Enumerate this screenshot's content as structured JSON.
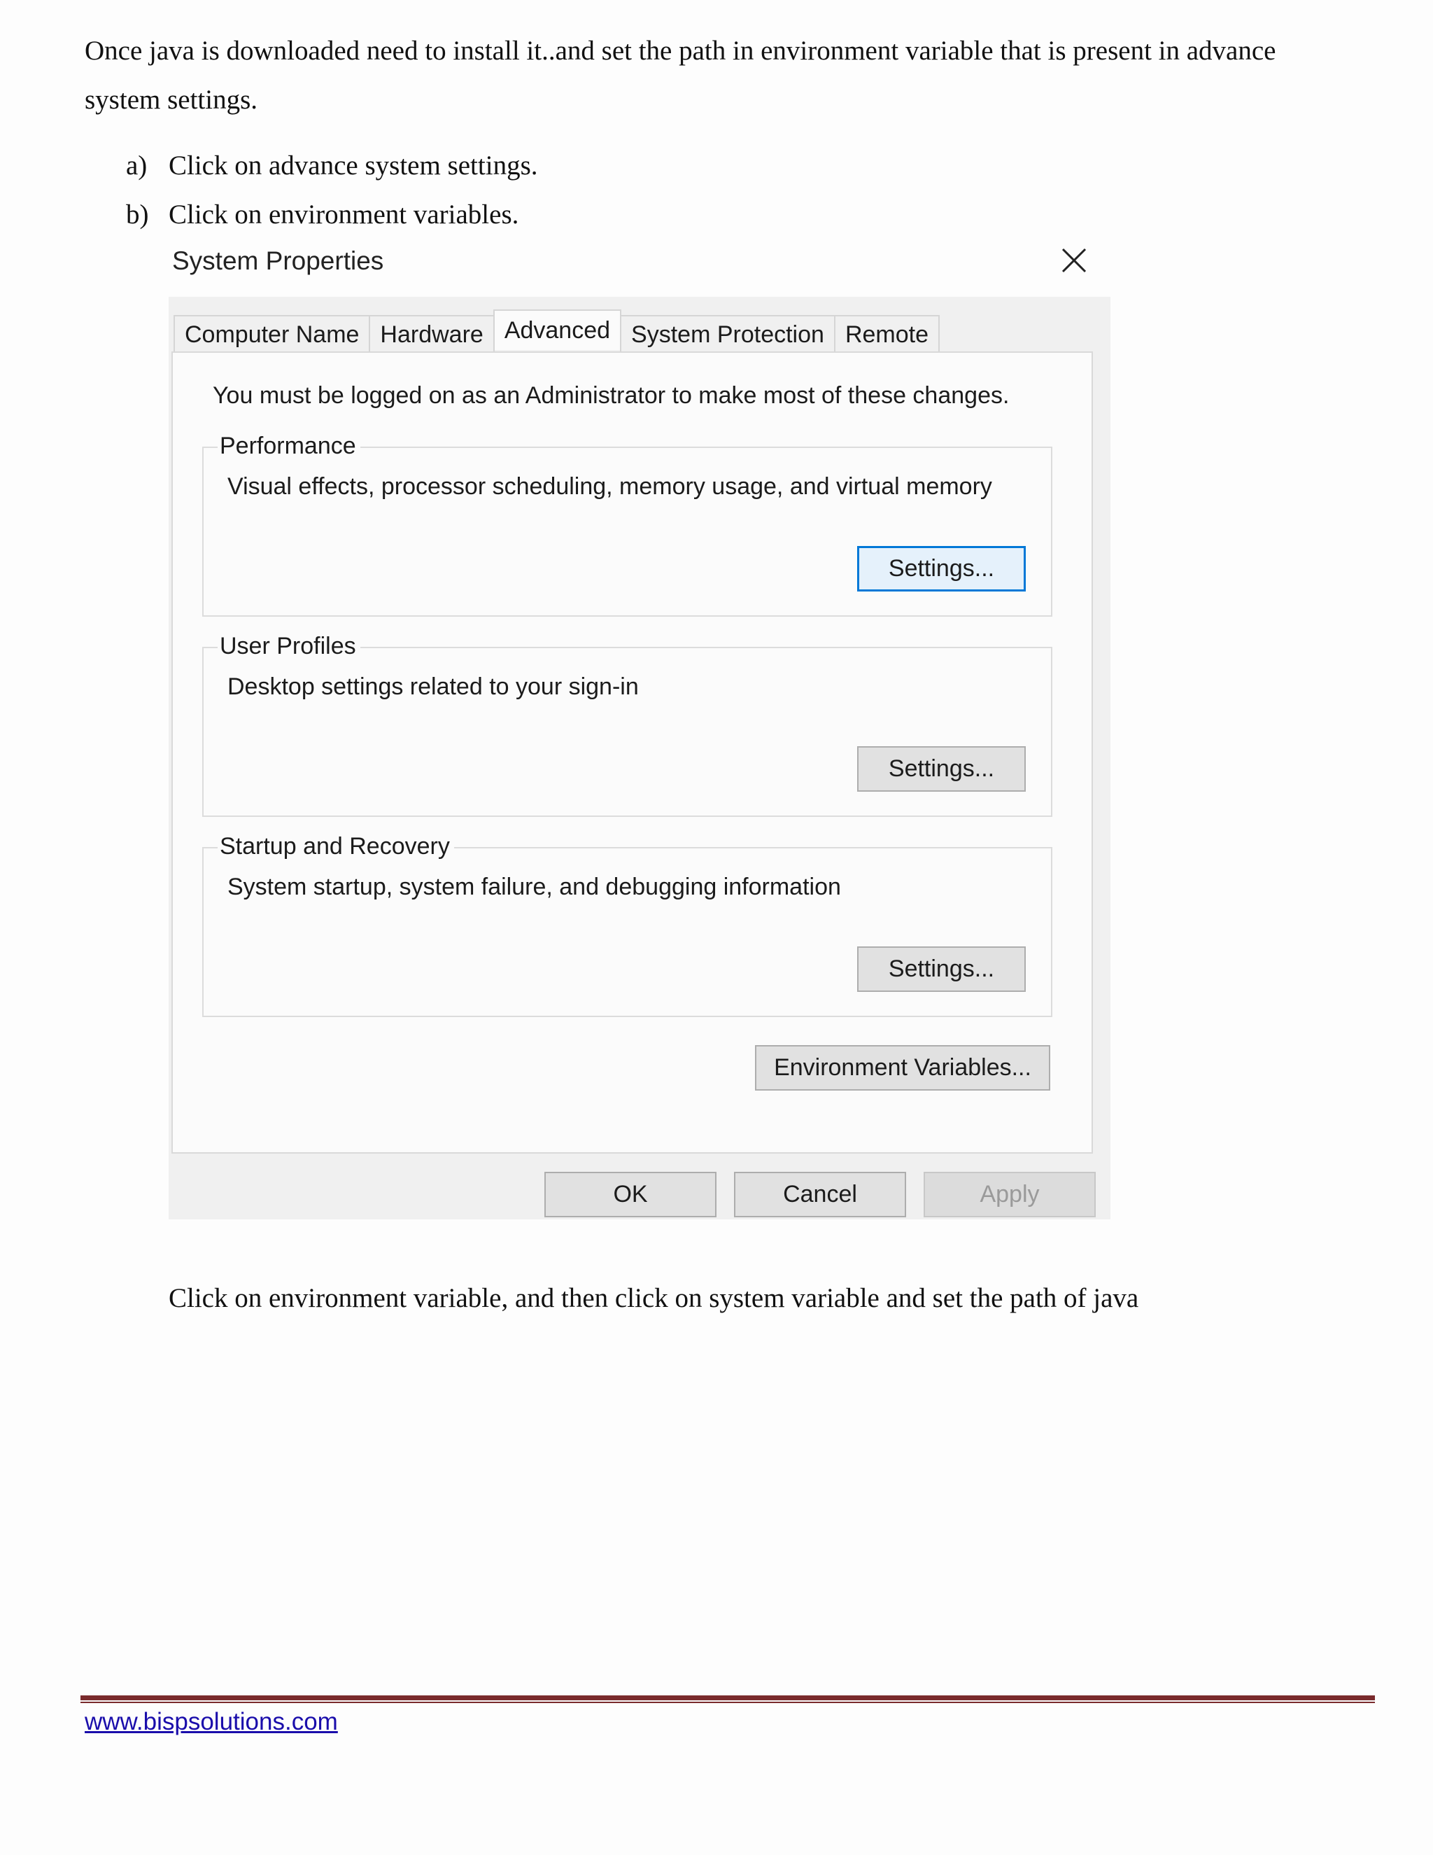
{
  "document": {
    "intro": "Once java is downloaded need to install it..and set the path in environment variable that is present in advance system settings.",
    "steps": [
      {
        "marker": "a)",
        "text": "Click on advance system settings."
      },
      {
        "marker": "b)",
        "text": "Click on environment variables."
      }
    ],
    "after_text": "Click on environment variable, and then click on system variable and set the path of java",
    "footer_link": "www.bispsolutions.com",
    "footer_rule_color": "#7a2b2d"
  },
  "dialog": {
    "title": "System Properties",
    "close_icon": "close-icon",
    "tabs": [
      "Computer Name",
      "Hardware",
      "Advanced",
      "System Protection",
      "Remote"
    ],
    "active_tab": "Advanced",
    "admin_note": "You must be logged on as an Administrator to make most of these changes.",
    "groups": [
      {
        "legend": "Performance",
        "description": "Visual effects, processor scheduling, memory usage, and virtual memory",
        "button": "Settings..."
      },
      {
        "legend": "User Profiles",
        "description": "Desktop settings related to your sign-in",
        "button": "Settings..."
      },
      {
        "legend": "Startup and Recovery",
        "description": "System startup, system failure, and debugging information",
        "button": "Settings..."
      }
    ],
    "env_button": "Environment Variables...",
    "ok_button": "OK",
    "cancel_button": "Cancel",
    "apply_button": "Apply",
    "focus_color": "#0078d7"
  }
}
